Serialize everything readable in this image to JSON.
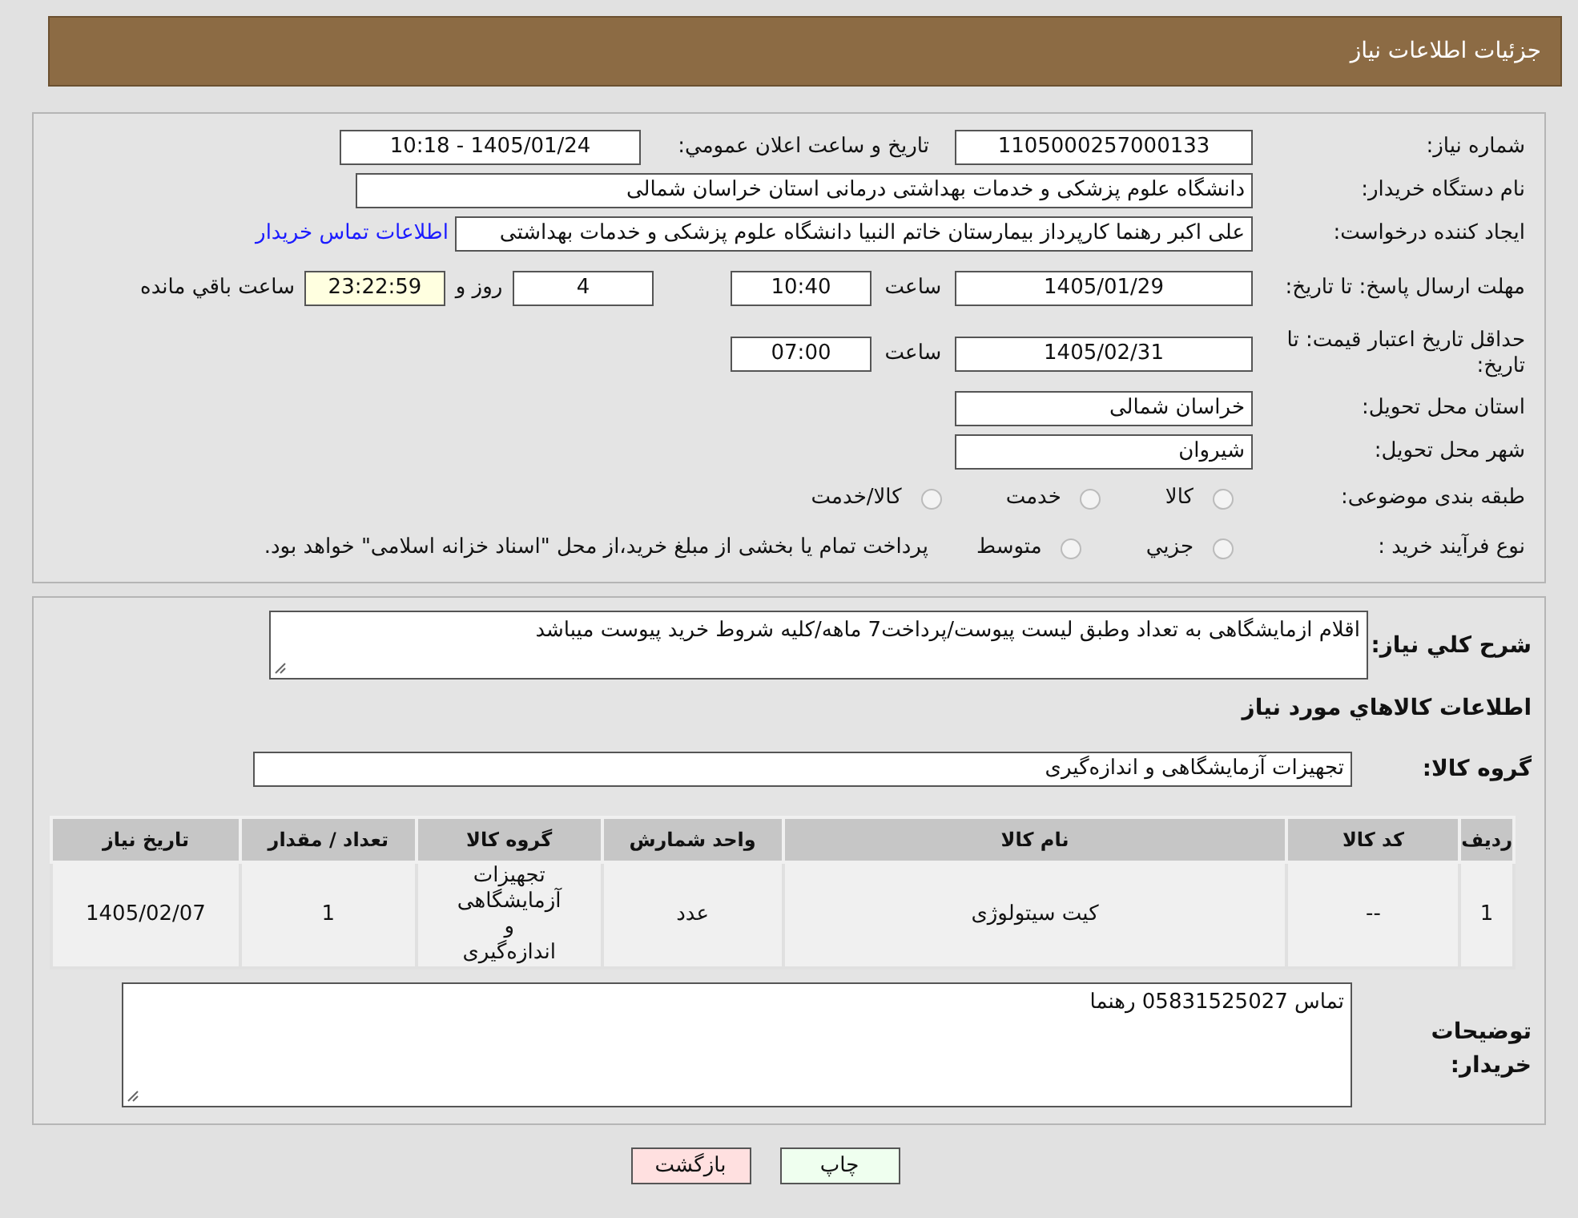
{
  "header": {
    "title": "جزئیات اطلاعات نیاز"
  },
  "need_number": {
    "label": "شماره نیاز:",
    "value": "1105000257000133"
  },
  "announce": {
    "label": "تاریخ و ساعت اعلان عمومي:",
    "value": "1405/01/24 - 10:18"
  },
  "buyer_org": {
    "label": "نام دستگاه خریدار:",
    "value": "دانشگاه علوم پزشکی و خدمات بهداشتی درمانی استان خراسان شمالی"
  },
  "requester": {
    "label": "ایجاد کننده درخواست:",
    "value": "علی اکبر رهنما کارپرداز بیمارستان خاتم النبیا دانشگاه علوم پزشکی و خدمات بهداشتی",
    "link": "اطلاعات تماس خریدار"
  },
  "deadline": {
    "label": "مهلت ارسال پاسخ: تا تاریخ:",
    "date": "1405/01/29",
    "time_label": "ساعت",
    "time": "10:40",
    "days": "4",
    "days_label": "روز و",
    "remaining": "23:22:59",
    "remaining_label": "ساعت باقي مانده"
  },
  "validity": {
    "label": "حداقل تاریخ اعتبار قیمت: تا تاریخ:",
    "date": "1405/02/31",
    "time_label": "ساعت",
    "time": "07:00"
  },
  "province": {
    "label": "استان محل تحویل:",
    "value": "خراسان شمالی"
  },
  "city": {
    "label": "شهر محل تحویل:",
    "value": "شیروان"
  },
  "category": {
    "label": "طبقه بندی موضوعی:",
    "options": [
      {
        "label": "کالا",
        "selected": false
      },
      {
        "label": "خدمت",
        "selected": false
      },
      {
        "label": "کالا/خدمت",
        "selected": false
      }
    ]
  },
  "purchase_type": {
    "label": "نوع فرآیند خرید :",
    "options": [
      {
        "label": "جزيي",
        "selected": false
      },
      {
        "label": "متوسط",
        "selected": false
      }
    ],
    "note": "پرداخت تمام یا بخشی از مبلغ خرید،از محل \"اسناد خزانه اسلامی\" خواهد بود."
  },
  "description": {
    "label": "شرح كلي نياز:",
    "value": "اقلام ازمایشگاهی به تعداد وطبق لیست پیوست/پرداخت7 ماهه/کلیه شروط خرید پیوست میباشد"
  },
  "goods_heading": "اطلاعات كالاهاي مورد نياز",
  "goods_group": {
    "label": "گروه کالا:",
    "value": "تجهیزات آزمایشگاهی و اندازه‌گیری"
  },
  "table": {
    "columns": [
      "ردیف",
      "کد کالا",
      "نام کالا",
      "واحد شمارش",
      "گروه کالا",
      "تعداد / مقدار",
      "تاریخ نیاز"
    ],
    "rows": [
      [
        "1",
        "--",
        "کیت سیتولوژی",
        "عدد",
        "تجهیزات آزمایشگاهی و اندازه‌گیری",
        "1",
        "1405/02/07"
      ]
    ]
  },
  "buyer_notes": {
    "label": "توضیحات خریدار:",
    "value": "تماس 05831525027 رهنما"
  },
  "buttons": [
    {
      "kind": "print",
      "label": "چاپ"
    },
    {
      "kind": "back",
      "label": "بازگشت"
    }
  ]
}
